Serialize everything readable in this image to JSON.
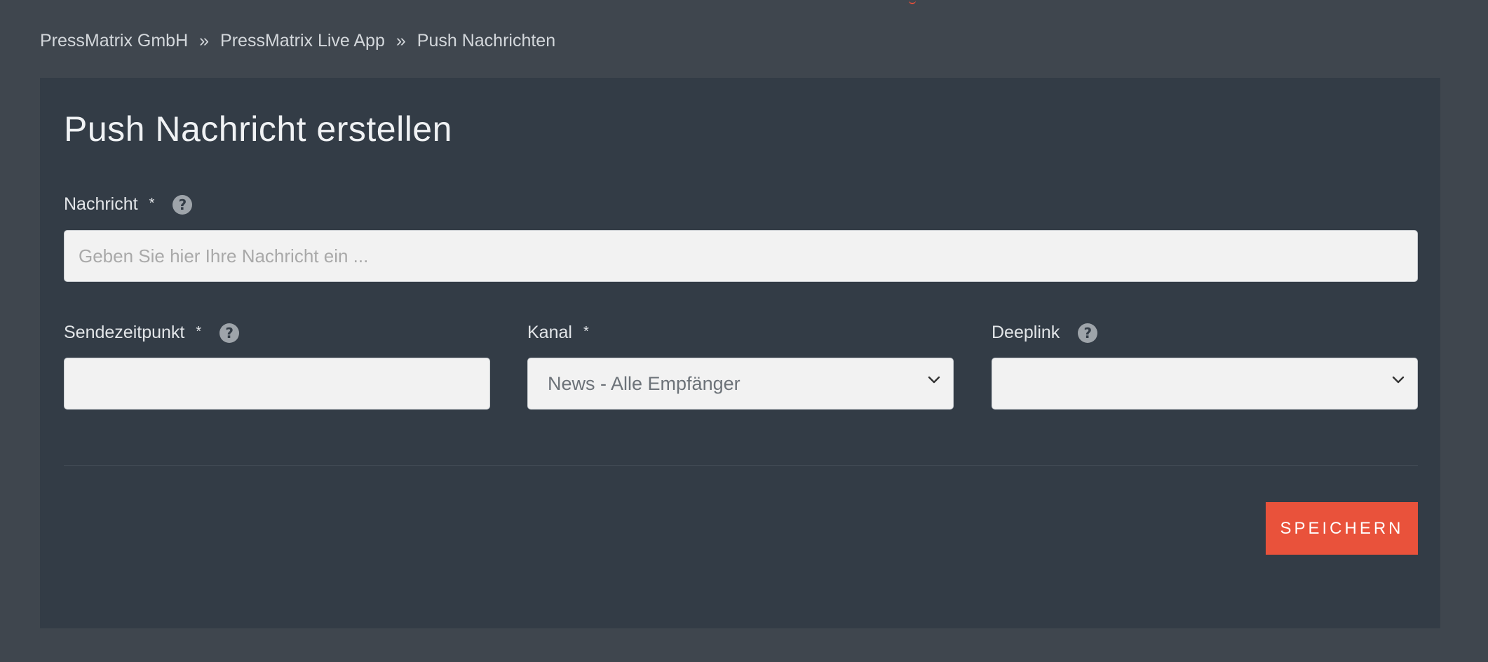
{
  "breadcrumb": {
    "items": [
      "PressMatrix GmbH",
      "PressMatrix Live App"
    ],
    "separator": "»",
    "current": "Push Nachrichten"
  },
  "form": {
    "title": "Push Nachricht erstellen",
    "required_marker": "*",
    "help_glyph": "?",
    "message": {
      "label": "Nachricht",
      "value": "",
      "placeholder": "Geben Sie hier Ihre Nachricht ein ..."
    },
    "send_time": {
      "label": "Sendezeitpunkt",
      "value": ""
    },
    "channel": {
      "label": "Kanal",
      "selected": "News - Alle Empfänger"
    },
    "deeplink": {
      "label": "Deeplink",
      "selected": ""
    },
    "save_label": "SPEICHERN"
  },
  "colors": {
    "background": "#3f464e",
    "panel": "#333c46",
    "accent": "#e9523b",
    "input_bg": "#f2f2f2"
  }
}
